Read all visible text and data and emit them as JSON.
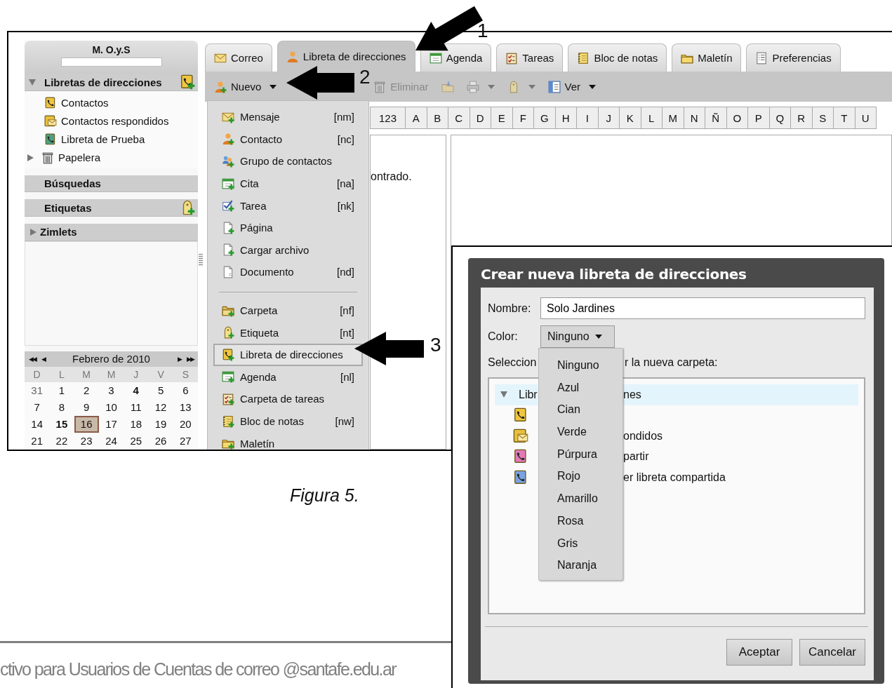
{
  "app": {
    "sidebar": {
      "account": "M. O.y.S",
      "sections": [
        {
          "kind": "addressbooks",
          "title": "Libretas de direcciones",
          "expanded": true,
          "items": [
            {
              "kind": "book",
              "label": "Contactos"
            },
            {
              "kind": "book-mail",
              "label": "Contactos respondidos"
            },
            {
              "kind": "book-green",
              "label": "Libreta de Prueba"
            },
            {
              "kind": "trash",
              "label": "Papelera",
              "expanded": false
            }
          ]
        },
        {
          "kind": "searches",
          "title": "Búsquedas"
        },
        {
          "kind": "tags",
          "title": "Etiquetas"
        },
        {
          "kind": "zimlets",
          "title": "Zimlets",
          "expanded": false
        }
      ]
    },
    "calendar": {
      "nav_back": [
        "◀◀",
        "◀"
      ],
      "month": "Febrero de 2010",
      "nav_forward": [
        "▶",
        "▶▶"
      ],
      "weekdays": [
        "D",
        "L",
        "M",
        "M",
        "J",
        "V",
        "S"
      ],
      "weeks": [
        [
          {
            "day": "31",
            "other_month": true
          },
          {
            "day": "1"
          },
          {
            "day": "2"
          },
          {
            "day": "3"
          },
          {
            "day": "4",
            "has_events": true
          },
          {
            "day": "5"
          },
          {
            "day": "6"
          }
        ],
        [
          {
            "day": "7"
          },
          {
            "day": "8"
          },
          {
            "day": "9"
          },
          {
            "day": "10"
          },
          {
            "day": "11"
          },
          {
            "day": "12"
          },
          {
            "day": "13"
          }
        ],
        [
          {
            "day": "14"
          },
          {
            "day": "15",
            "has_events": true
          },
          {
            "day": "16",
            "selected": true
          },
          {
            "day": "17"
          },
          {
            "day": "18"
          },
          {
            "day": "19"
          },
          {
            "day": "20"
          }
        ],
        [
          {
            "day": "21"
          },
          {
            "day": "22"
          },
          {
            "day": "23"
          },
          {
            "day": "24"
          },
          {
            "day": "25"
          },
          {
            "day": "26"
          },
          {
            "day": "27"
          }
        ]
      ]
    },
    "tabs": [
      {
        "kind": "mail",
        "label": "Correo",
        "selected": false
      },
      {
        "kind": "person",
        "label": "Libreta de direcciones",
        "selected": true
      },
      {
        "kind": "calendar",
        "label": "Agenda",
        "selected": false
      },
      {
        "kind": "tasks",
        "label": "Tareas",
        "selected": false
      },
      {
        "kind": "notes",
        "label": "Bloc de notas",
        "selected": false
      },
      {
        "kind": "briefcase",
        "label": "Maletín",
        "selected": false
      },
      {
        "kind": "prefs",
        "label": "Preferencias",
        "selected": false
      }
    ],
    "toolbar": [
      {
        "kind": "person-add",
        "label": "Nuevo",
        "dropdown": true,
        "disabled": false
      },
      {
        "kind": "trash",
        "label": "Eliminar",
        "disabled": true
      },
      {
        "kind": "move",
        "disabled": true
      },
      {
        "kind": "printer",
        "dropdown": true,
        "disabled": true
      },
      {
        "kind": "tag",
        "dropdown": true,
        "disabled": true
      },
      {
        "kind": "view",
        "label": "Ver",
        "dropdown": true,
        "disabled": false
      }
    ],
    "letters": [
      "123",
      "A",
      "B",
      "C",
      "D",
      "E",
      "F",
      "G",
      "H",
      "I",
      "J",
      "K",
      "L",
      "M",
      "N",
      "Ñ",
      "O",
      "P",
      "Q",
      "R",
      "S",
      "T",
      "U"
    ],
    "list_message": "ontrado.",
    "new_menu": [
      [
        {
          "kind": "mail-add",
          "label": "Mensaje",
          "shortcut": "[nm]",
          "highlighted": false
        },
        {
          "kind": "person-add",
          "label": "Contacto",
          "shortcut": "[nc]",
          "highlighted": false
        },
        {
          "kind": "people-add",
          "label": "Grupo de contactos",
          "highlighted": false
        },
        {
          "kind": "calendar-add",
          "label": "Cita",
          "shortcut": "[na]",
          "highlighted": false
        },
        {
          "kind": "check-add",
          "label": "Tarea",
          "shortcut": "[nk]",
          "highlighted": false
        },
        {
          "kind": "page-add",
          "label": "Página",
          "highlighted": false
        },
        {
          "kind": "page-add",
          "label": "Cargar archivo",
          "highlighted": false
        },
        {
          "kind": "page",
          "label": "Documento",
          "shortcut": "[nd]",
          "highlighted": false
        }
      ],
      [
        {
          "kind": "folder-add",
          "label": "Carpeta",
          "shortcut": "[nf]",
          "highlighted": false
        },
        {
          "kind": "tag-add",
          "label": "Etiqueta",
          "shortcut": "[nt]",
          "highlighted": false
        },
        {
          "kind": "book-add",
          "label": "Libreta de direcciones",
          "highlighted": true
        },
        {
          "kind": "calendar-add",
          "label": "Agenda",
          "shortcut": "[nl]",
          "highlighted": false
        },
        {
          "kind": "tasks-add",
          "label": "Carpeta de tareas",
          "highlighted": false
        },
        {
          "kind": "notes-add",
          "label": "Bloc de notas",
          "shortcut": "[nw]",
          "highlighted": false
        },
        {
          "kind": "briefcase-add",
          "label": "Maletín",
          "highlighted": false
        }
      ]
    ]
  },
  "arrows": [
    {
      "number": "1"
    },
    {
      "number": "2"
    },
    {
      "number": "3"
    }
  ],
  "caption": "Figura 5.",
  "dialog": {
    "title": "Crear nueva libreta de direcciones",
    "name_label": "Nombre:",
    "name_value": "Solo Jardines",
    "color_label": "Color:",
    "color_value": "Ninguno",
    "location_start": "Seleccion",
    "location_end": "r la nueva carpeta:",
    "tree": [
      {
        "start": "Libr",
        "end": "nes",
        "expanded": true,
        "selected": true
      },
      {
        "kind": "book",
        "selected": false
      },
      {
        "kind": "book-mail",
        "end": "ondidos",
        "selected": false
      },
      {
        "kind": "book-pink",
        "end": "partir",
        "selected": false
      },
      {
        "kind": "book-blue",
        "end": "er libreta compartida",
        "selected": false
      }
    ],
    "color_options": [
      "Ninguno",
      "Azul",
      "Cian",
      "Verde",
      "Púrpura",
      "Rojo",
      "Amarillo",
      "Rosa",
      "Gris",
      "Naranja"
    ],
    "buttons": [
      "Aceptar",
      "Cancelar"
    ]
  },
  "footer": "ctivo para Usuarios de Cuentas de correo @santafe.edu.ar"
}
